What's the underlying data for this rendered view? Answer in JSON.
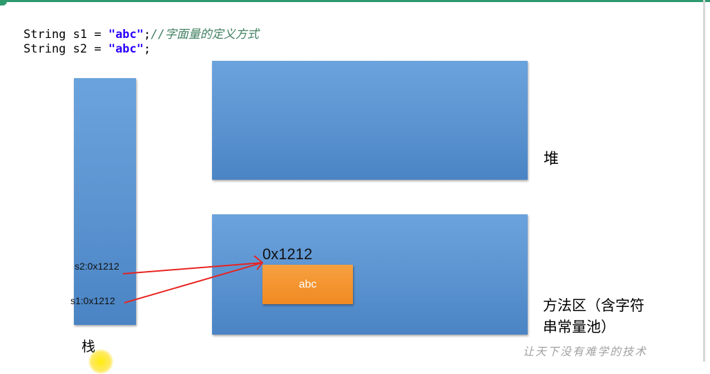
{
  "code": {
    "line1": {
      "prefix": "String s1 = ",
      "literal": "\"abc\"",
      "semicolon": ";",
      "comment": "//字面量的定义方式"
    },
    "line2": {
      "prefix": "String s2 = ",
      "literal": "\"abc\"",
      "semicolon": ";"
    }
  },
  "diagram": {
    "stack_label": "栈",
    "heap_label": "堆",
    "method_area_label_line1": "方法区（含字符",
    "method_area_label_line2": "串常量池）",
    "s2_ref": "s2:0x1212",
    "s1_ref": "s1:0x1212",
    "pool_address": "0x1212",
    "pool_value": "abc"
  },
  "watermark": "让天下没有难学的技术",
  "colors": {
    "region_blue": "#5b93d0",
    "string_box_orange": "#f08a22",
    "arrow_red": "#e8231f",
    "code_literal": "#2a00ff",
    "code_comment": "#3f7f5f"
  }
}
